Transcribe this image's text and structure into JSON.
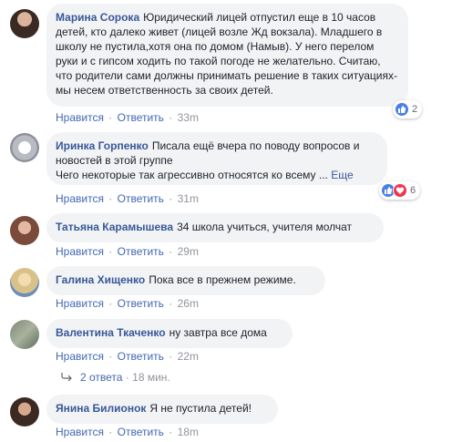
{
  "comments": [
    {
      "author": "Марина Сорока",
      "text": "Юридический лицей отпустил еще в 10 часов детей, кто далеко живет (лицей возле Жд вокзала). Младшего в школу не пустила,хотя она по домом (Намыв). У него перелом руки и с гипсом ходить по такой погоде не желательно. Считаю, что родители сами должны принимать решение в таких ситуациях- мы несем ответственность за своих детей.",
      "like": "Нравится",
      "reply": "Ответить",
      "time": "33m",
      "reactions_count": "2"
    },
    {
      "author": "Иринка Горпенко",
      "text": "Писала ещё вчера по поводу вопросов и новостей в этой группе\nЧего некоторые так агрессивно относятся ко всему ...",
      "more": "Еще",
      "like": "Нравится",
      "reply": "Ответить",
      "time": "31m",
      "reactions_count": "6"
    },
    {
      "author": "Татьяна Карамышева",
      "text": "34 школа учиться, учителя молчат",
      "like": "Нравится",
      "reply": "Ответить",
      "time": "29m"
    },
    {
      "author": "Галина Хищенко",
      "text": "Пока все в прежнем режиме.",
      "like": "Нравится",
      "reply": "Ответить",
      "time": "26m"
    },
    {
      "author": "Валентина Ткаченко",
      "text": "ну завтра все дома",
      "like": "Нравится",
      "reply": "Ответить",
      "time": "22m"
    },
    {
      "author": "Янина Билионок",
      "text": "Я не пустила детей!",
      "like": "Нравится",
      "reply": "Ответить",
      "time": "18m"
    }
  ],
  "replies_link": {
    "label": "2 ответа",
    "time": "18 мин."
  },
  "colors": {
    "link": "#385898",
    "action": "#4267b2",
    "muted": "#90949c",
    "bubble": "#f2f3f5",
    "like": "#4a7fe6",
    "love": "#f0364f"
  }
}
